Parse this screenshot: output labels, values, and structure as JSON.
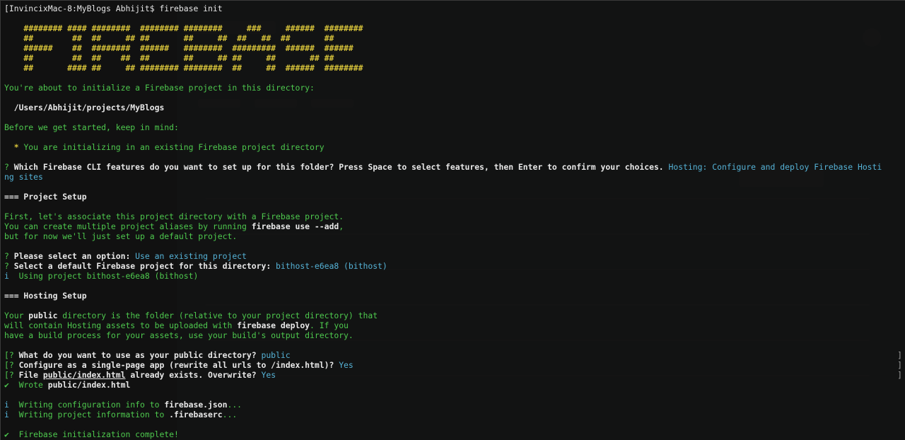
{
  "prompt": "[InvincixMac-8:MyBlogs Abhijit$ firebase init",
  "logo": [
    "    ######## #### ########  ######## ########     ###     ######  ########",
    "    ##        ##  ##     ## ##       ##     ##  ##   ##  ##       ##",
    "    ######    ##  ########  ######   ########  #########  ######  ######",
    "    ##        ##  ##    ##  ##       ##     ## ##     ##       ## ##",
    "    ##       #### ##     ## ######## ########  ##     ##  ######  ########"
  ],
  "intro": "You're about to initialize a Firebase project in this directory:",
  "dir_path": "  /Users/Abhijit/projects/MyBlogs",
  "before_start": "Before we get started, keep in mind:",
  "warn_bullet": "  * ",
  "warn_text": "You are initializing in an existing Firebase project directory",
  "q1_mark": "? ",
  "q1_text": "Which Firebase CLI features do you want to set up for this folder? Press Space to select features, then Enter to confirm your choices.",
  "q1_answer": " Hosting: Configure and deploy Firebase Hosti",
  "q1_answer_wrap": "ng sites",
  "project_setup": "=== Project Setup",
  "assoc1": "First, let's associate this project directory with a Firebase project.",
  "assoc2_a": "You can create multiple project aliases by running ",
  "assoc2_cmd": "firebase use --add",
  "assoc2_b": ",",
  "assoc3": "but for now we'll just set up a default project.",
  "q2_mark": "? ",
  "q2_text": "Please select an option:",
  "q2_answer": " Use an existing project",
  "q3_mark": "? ",
  "q3_text": "Select a default Firebase project for this directory:",
  "q3_answer": " bithost-e6ea8 (bithost)",
  "info1_mark": "i  ",
  "info1_text": "Using project bithost-e6ea8 (bithost)",
  "hosting_setup": "=== Hosting Setup",
  "pub1_a": "Your ",
  "pub1_b": "public",
  "pub1_c": " directory is the folder (relative to your project directory) that",
  "pub2_a": "will contain Hosting assets to be uploaded with ",
  "pub2_b": "firebase deploy",
  "pub2_c": ". If you",
  "pub3": "have a build process for your assets, use your build's output directory.",
  "q4_mark": "[? ",
  "q4_text": "What do you want to use as your public directory?",
  "q4_answer": " public",
  "q5_mark": "[? ",
  "q5_text": "Configure as a single-page app (rewrite all urls to /index.html)?",
  "q5_answer": " Yes",
  "q6_mark": "[? ",
  "q6_text_a": "File ",
  "q6_text_file": "public/index.html",
  "q6_text_b": " already exists. Overwrite?",
  "q6_answer": " Yes",
  "bracket": "]",
  "wrote_mark": "✔  ",
  "wrote_text": "Wrote ",
  "wrote_file": "public/index.html",
  "info2_mark": "i  ",
  "info2_text": "Writing configuration info to ",
  "info2_file": "firebase.json",
  "info2_dots": "...",
  "info3_mark": "i  ",
  "info3_text": "Writing project information to ",
  "info3_file": ".firebaserc",
  "info3_dots": "...",
  "done_mark": "✔  ",
  "done_text": "Firebase initialization complete!"
}
